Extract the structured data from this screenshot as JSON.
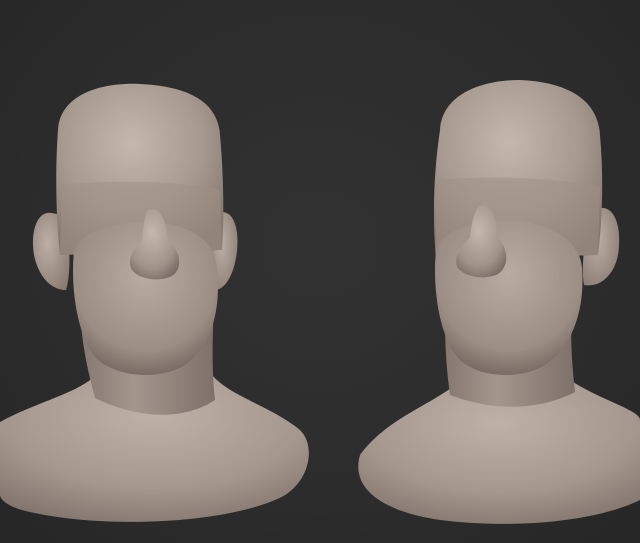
{
  "scene": {
    "background_color": "#2c2c2c",
    "clay_color": "#a3948a",
    "clay_highlight": "#c3b6ad",
    "clay_shadow": "#6c5f57",
    "models": [
      {
        "name": "left-sculpt-head",
        "view": "front"
      },
      {
        "name": "right-sculpt-head",
        "view": "three-quarter"
      }
    ]
  }
}
